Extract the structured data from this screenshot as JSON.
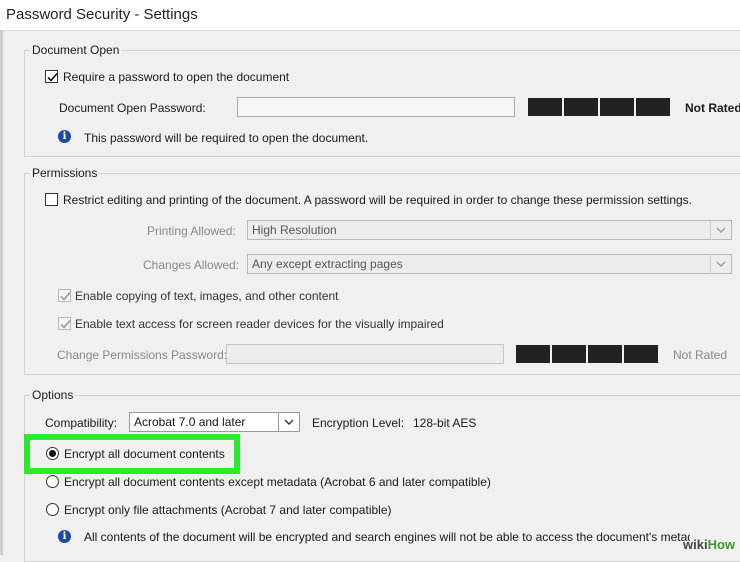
{
  "window": {
    "title": "Password Security - Settings"
  },
  "document_open": {
    "legend": "Document Open",
    "require_password_label": "Require a password to open the document",
    "require_password_checked": true,
    "password_label": "Document Open Password:",
    "password_value": "",
    "strength_text": "Not Rated",
    "info_text": "This password will be required to open the document."
  },
  "permissions": {
    "legend": "Permissions",
    "restrict_label": "Restrict editing and printing of the document. A password will be required in order to change these permission settings.",
    "restrict_checked": false,
    "printing_label": "Printing Allowed:",
    "printing_value": "High Resolution",
    "changes_label": "Changes Allowed:",
    "changes_value": "Any except extracting pages",
    "copy_label": "Enable copying of text, images, and other content",
    "copy_checked": true,
    "screen_reader_label": "Enable text access for screen reader devices for the visually impaired",
    "screen_reader_checked": true,
    "change_password_label": "Change Permissions Password:",
    "change_password_value": "",
    "strength_text": "Not Rated"
  },
  "options": {
    "legend": "Options",
    "compat_label": "Compatibility:",
    "compat_value": "Acrobat 7.0 and later",
    "encryption_label": "Encryption  Level:",
    "encryption_value": "128-bit AES",
    "radio_all": "Encrypt all document contents",
    "radio_except_metadata": "Encrypt all document contents except metadata (Acrobat 6 and later compatible)",
    "radio_attachments": "Encrypt only file attachments (Acrobat 7 and later compatible)",
    "selected": "radio_all",
    "info_text": "All contents of the document will be encrypted and search engines will not be able to access the document's metadata."
  },
  "watermark": {
    "prefix": "wiki",
    "suffix": "How"
  },
  "colors": {
    "highlight": "#2bea2b",
    "info_icon": "#1c4aa3",
    "meter": "#222222"
  }
}
